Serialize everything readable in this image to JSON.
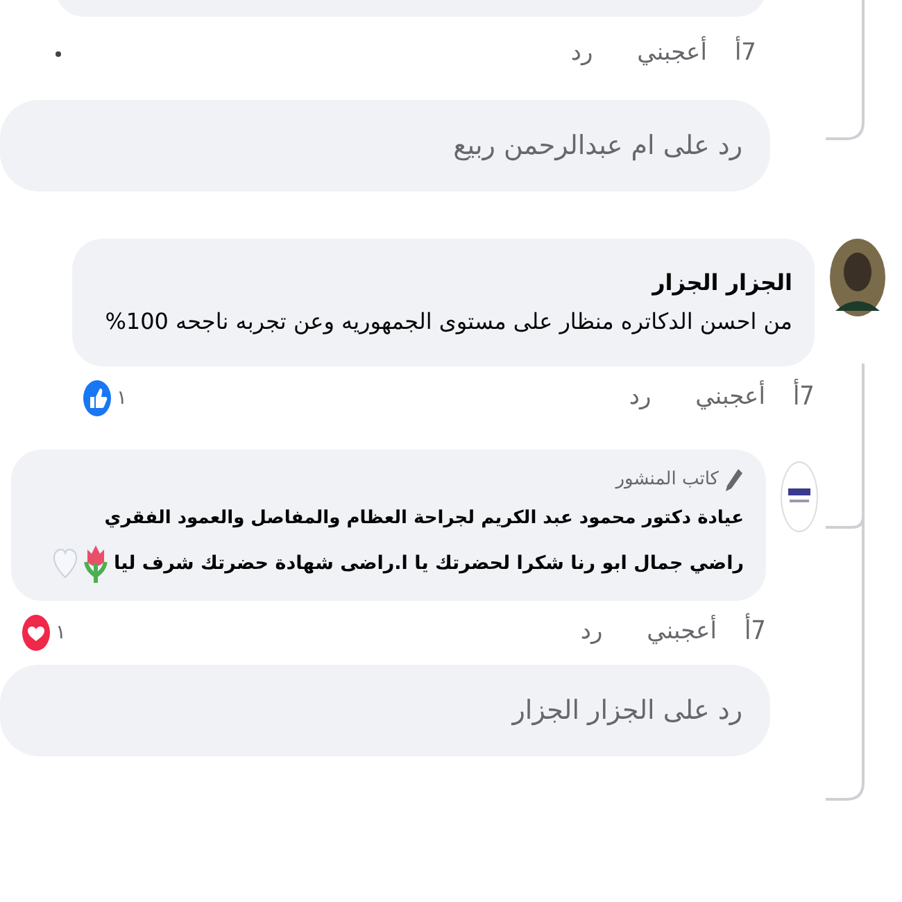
{
  "top_actions": {
    "time": "7أ",
    "like": "أعجبني",
    "reply": "رد"
  },
  "reply_field_1": {
    "placeholder": "رد على ام عبدالرحمن ربيع"
  },
  "comment": {
    "author": "الجزار الجزار",
    "text": "من احسن الدكاتره منظار على مستوى الجمهوريه وعن تجربه ناجحه 100%",
    "time": "7أ",
    "like": "أعجبني",
    "reply": "رد",
    "reaction": {
      "kind": "like",
      "count": "١"
    }
  },
  "author_reply": {
    "badge": "كاتب المنشور",
    "author": "عيادة دكتور محمود عبد الكريم لجراحة العظام والمفاصل والعمود الفقري",
    "text": "راضي جمال ابو رنا شكرا لحضرتك يا ا.راضى شهادة حضرتك شرف ليا",
    "time": "7أ",
    "like": "أعجبني",
    "reply": "رد",
    "reaction": {
      "kind": "love",
      "count": "١"
    }
  },
  "reply_field_2": {
    "placeholder": "رد على الجزار الجزار"
  }
}
